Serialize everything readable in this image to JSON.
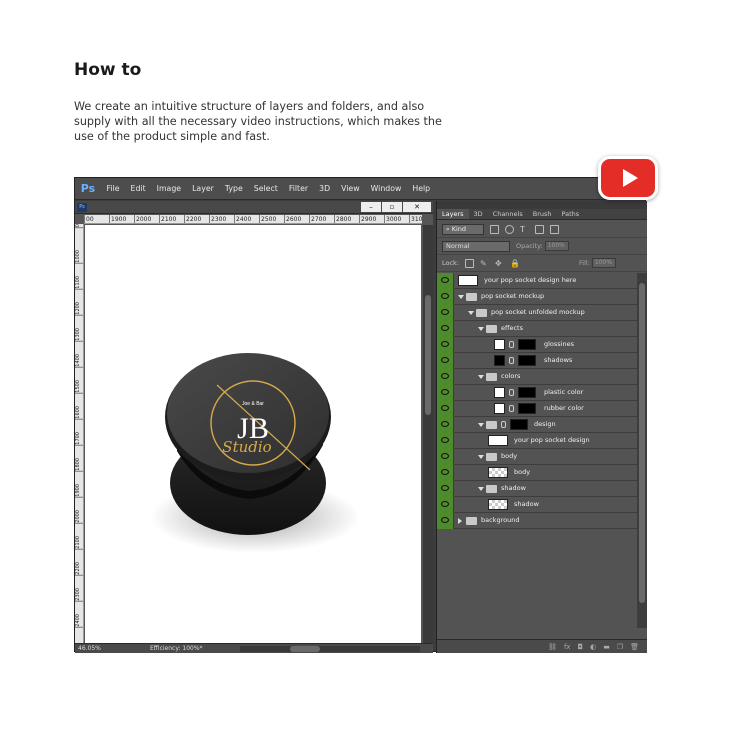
{
  "header": {
    "title": "How to",
    "description": "We create an intuitive structure of layers and folders, and also supply with all the necessary video instructions, which makes the use of the product simple and fast."
  },
  "youtube": {
    "icon": "youtube-play-icon",
    "color": "#e52d27"
  },
  "app": {
    "logo": "Ps",
    "menu": [
      "File",
      "Edit",
      "Image",
      "Layer",
      "Type",
      "Select",
      "Filter",
      "3D",
      "View",
      "Window",
      "Help"
    ]
  },
  "document": {
    "ruler_h": [
      "00",
      "1900",
      "2000",
      "2100",
      "2200",
      "2300",
      "2400",
      "2500",
      "2600",
      "2700",
      "2800",
      "2900",
      "3000",
      "3100"
    ],
    "ruler_v": [
      "0",
      "1000",
      "1100",
      "1200",
      "1300",
      "1400",
      "1500",
      "1600",
      "1700",
      "1800",
      "1900",
      "2000",
      "2100",
      "2200",
      "2300",
      "2400"
    ],
    "zoom": "46.05%",
    "efficiency": "Efficiency: 100%*",
    "artwork": {
      "monogram": "JB",
      "script": "Studio",
      "tagline": "Joe & Bar"
    }
  },
  "panel": {
    "tabs": [
      "Layers",
      "3D",
      "Channels",
      "Brush",
      "Paths"
    ],
    "filter_label": "Kind",
    "blend_mode": "Normal",
    "opacity_label": "Opacity:",
    "opacity_value": "100%",
    "lock_label": "Lock:",
    "fill_label": "Fill:",
    "fill_value": "100%",
    "bottom_icons": [
      "link-icon",
      "fx-icon",
      "mask-icon",
      "adjustment-icon",
      "folder-icon",
      "new-layer-icon",
      "trash-icon"
    ]
  },
  "layers": [
    {
      "name": "your pop socket design here",
      "kind": "smart",
      "indent": 0,
      "expanded": null
    },
    {
      "name": "pop socket mockup",
      "kind": "folder",
      "indent": 0,
      "expanded": true
    },
    {
      "name": "pop socket unfolded mockup",
      "kind": "folder",
      "indent": 1,
      "expanded": true
    },
    {
      "name": "effects",
      "kind": "folder",
      "indent": 2,
      "expanded": true
    },
    {
      "name": "glossines",
      "kind": "masked-white",
      "indent": 3,
      "expanded": null
    },
    {
      "name": "shadows",
      "kind": "masked-black",
      "indent": 3,
      "expanded": null
    },
    {
      "name": "colors",
      "kind": "folder",
      "indent": 2,
      "expanded": true
    },
    {
      "name": "plastic color",
      "kind": "masked-white",
      "indent": 3,
      "expanded": null
    },
    {
      "name": "rubber color",
      "kind": "masked-white",
      "indent": 3,
      "expanded": null
    },
    {
      "name": "design",
      "kind": "folder-masked",
      "indent": 2,
      "expanded": true
    },
    {
      "name": "your pop socket design",
      "kind": "smart",
      "indent": 3,
      "expanded": null
    },
    {
      "name": "body",
      "kind": "folder",
      "indent": 2,
      "expanded": true
    },
    {
      "name": "body",
      "kind": "transparent",
      "indent": 3,
      "expanded": null
    },
    {
      "name": "shadow",
      "kind": "folder",
      "indent": 2,
      "expanded": true
    },
    {
      "name": "shadow",
      "kind": "transparent",
      "indent": 3,
      "expanded": null
    },
    {
      "name": "background",
      "kind": "folder",
      "indent": 0,
      "expanded": false
    }
  ]
}
